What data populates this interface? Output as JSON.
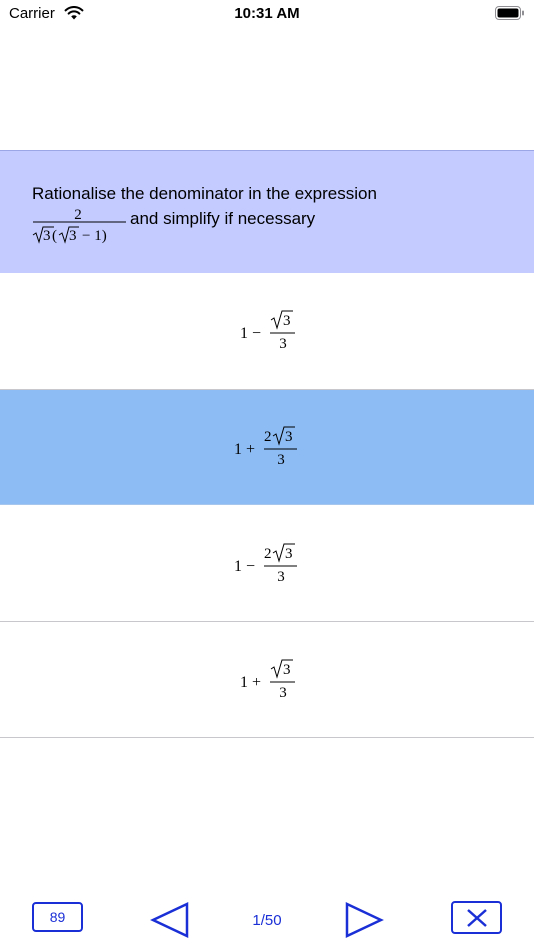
{
  "status_bar": {
    "carrier": "Carrier",
    "time": "10:31 AM"
  },
  "question": {
    "text_line1": "Rationalise the denominator in the expression",
    "text_line2": "and simplify if necessary",
    "expression": {
      "numerator": "2",
      "denominator_radicand_outer": "3",
      "denominator_paren_open": "(",
      "denominator_radicand_inner": "3",
      "denominator_rest": "− 1)"
    }
  },
  "answers": [
    {
      "lead": "1 −",
      "coef": "",
      "radicand": "3",
      "den": "3",
      "selected": false
    },
    {
      "lead": "1 +",
      "coef": "2",
      "radicand": "3",
      "den": "3",
      "selected": true
    },
    {
      "lead": "1 −",
      "coef": "2",
      "radicand": "3",
      "den": "3",
      "selected": false
    },
    {
      "lead": "1 +",
      "coef": "",
      "radicand": "3",
      "den": "3",
      "selected": false
    }
  ],
  "toolbar": {
    "count_label": "89",
    "page_indicator": "1/50"
  },
  "colors": {
    "question_bg": "#c3cbff",
    "selected_bg": "#8dbcf4",
    "accent": "#1a2fd6"
  }
}
